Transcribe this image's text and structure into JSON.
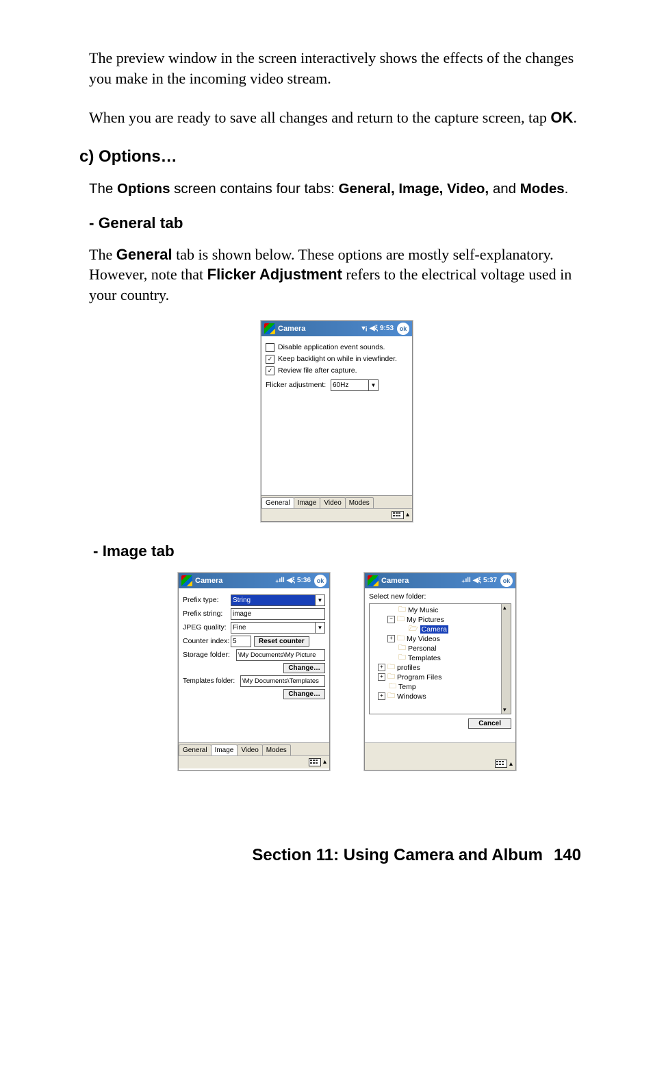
{
  "para1": "The preview window in the screen interactively shows the effects of the changes you make in the incoming video stream.",
  "para2_a": "When you are ready to save all changes and return to the capture screen, tap ",
  "para2_b": "OK",
  "para2_c": ".",
  "heading_c": "c) Options…",
  "options_para_a": "The ",
  "options_para_b": "Options",
  "options_para_c": " screen contains four tabs: ",
  "options_para_d": "General, Image, Video,",
  "options_para_e": " and ",
  "options_para_f": "Modes",
  "options_para_g": ".",
  "sub_general": "- General tab",
  "general_para_a": "The ",
  "general_para_b": "General",
  "general_para_c": " tab is shown below. These options are mostly self-explanatory. However, note that ",
  "general_para_d": "Flicker Adjustment",
  "general_para_e": " refers to the electrical voltage used in your country.",
  "sub_image": "- Image tab",
  "footer_title": "Section 11: Using Camera and Album",
  "footer_num": "140",
  "pda1": {
    "title": "Camera",
    "signal": "▾¡",
    "speaker": "◀ξ",
    "time": "9:53",
    "ok": "ok",
    "cb1": "Disable application event sounds.",
    "cb2": "Keep backlight on while in viewfinder.",
    "cb3": "Review file after capture.",
    "flicker_label": "Flicker adjustment:",
    "flicker_value": "60Hz",
    "tabs": [
      "General",
      "Image",
      "Video",
      "Modes"
    ]
  },
  "pda2": {
    "title": "Camera",
    "signal": "₊ıll",
    "speaker": "◀ξ",
    "time": "5:36",
    "ok": "ok",
    "prefix_type_label": "Prefix type:",
    "prefix_type_value": "String",
    "prefix_string_label": "Prefix string:",
    "prefix_string_value": "image",
    "jpeg_label": "JPEG quality:",
    "jpeg_value": "Fine",
    "counter_label": "Counter index:",
    "counter_value": "5",
    "reset_btn": "Reset counter",
    "storage_label": "Storage folder:",
    "storage_value": "\\My Documents\\My Picture",
    "change_btn": "Change…",
    "templates_label": "Templates folder:",
    "templates_value": "\\My Documents\\Templates",
    "tabs": [
      "General",
      "Image",
      "Video",
      "Modes"
    ]
  },
  "pda3": {
    "title": "Camera",
    "signal": "₊ıll",
    "speaker": "◀ξ",
    "time": "5:37",
    "ok": "ok",
    "select_label": "Select new folder:",
    "tree": {
      "n1": "My Music",
      "n2": "My Pictures",
      "n3": "Camera",
      "n4": "My Videos",
      "n5": "Personal",
      "n6": "Templates",
      "n7": "profiles",
      "n8": "Program Files",
      "n9": "Temp",
      "n10": "Windows"
    },
    "cancel": "Cancel"
  }
}
